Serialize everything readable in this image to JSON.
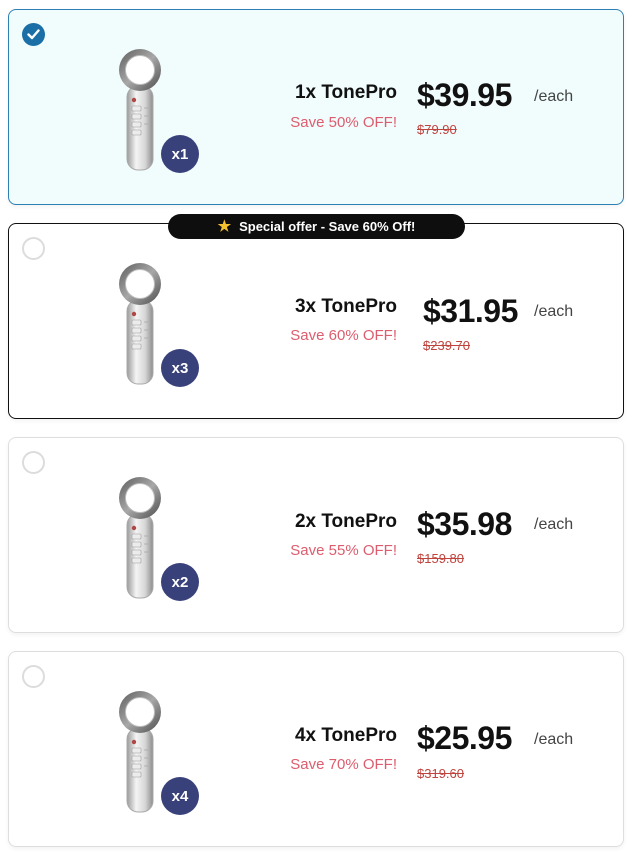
{
  "offer_banner": {
    "icon": "star-icon",
    "text": "Special offer - Save 60% Off!"
  },
  "colors": {
    "selected_border": "#2d80b5",
    "selected_background": "#f1fcfd",
    "badge": "#39417a",
    "save_text": "#dd5d6e",
    "old_price": "#c0443e"
  },
  "options": [
    {
      "selected": true,
      "badge": "x1",
      "title": "1x TonePro",
      "save": "Save 50% OFF!",
      "price": "$39.95",
      "unit": "/each",
      "old_price": "$79.90"
    },
    {
      "selected": false,
      "badge": "x3",
      "title": "3x TonePro",
      "save": "Save 60% OFF!",
      "price": "$31.95",
      "unit": "/each",
      "old_price": "$239.70"
    },
    {
      "selected": false,
      "badge": "x2",
      "title": "2x TonePro",
      "save": "Save 55% OFF!",
      "price": "$35.98",
      "unit": "/each",
      "old_price": "$159.80"
    },
    {
      "selected": false,
      "badge": "x4",
      "title": "4x TonePro",
      "save": "Save 70% OFF!",
      "price": "$25.95",
      "unit": "/each",
      "old_price": "$319.60"
    }
  ]
}
